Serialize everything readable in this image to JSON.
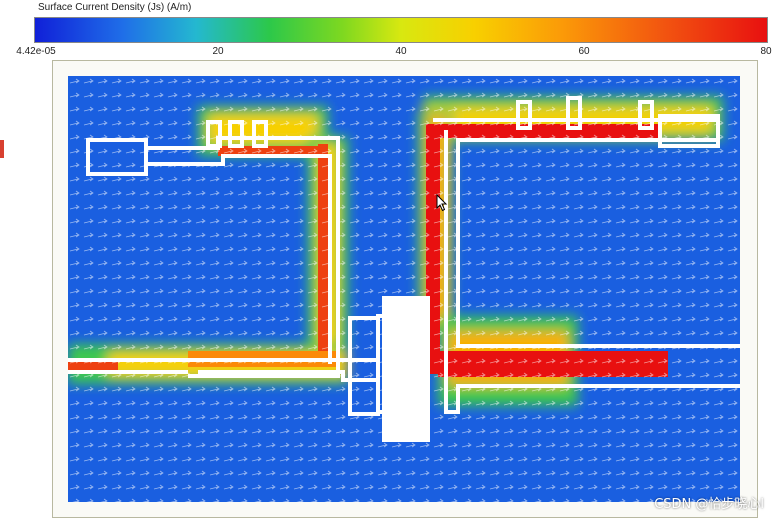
{
  "legend": {
    "title": "Surface Current Density (Js) (A/m)",
    "ticks": [
      "4.42e-05",
      "20",
      "40",
      "60",
      "80"
    ],
    "tick_values": [
      0,
      20,
      40,
      60,
      80
    ],
    "range": [
      4.42e-05,
      80
    ],
    "colormap": [
      "#1020d8",
      "#1f6ee8",
      "#24b8d0",
      "#2cc84a",
      "#d8e810",
      "#f8d000",
      "#fb9a08",
      "#e81010"
    ]
  },
  "plot": {
    "background_color": "#1a5fe0",
    "trace_color": "#ffffff",
    "field_label": "surface-current-vector-field"
  },
  "watermark": "CSDN @恰步晓心l"
}
